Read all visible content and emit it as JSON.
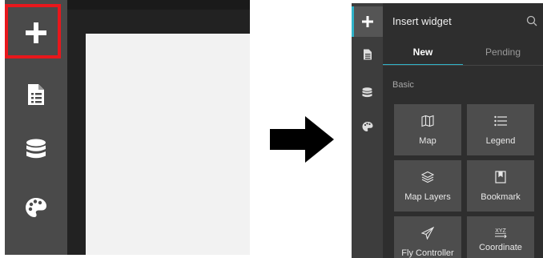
{
  "colors": {
    "highlight": "#e8171c",
    "accent": "#2fb2c8",
    "sidebar_bg": "#4a4a4a",
    "panel_bg": "#2e2e2e",
    "tile_bg": "#4d4d4d"
  },
  "left": {
    "icons": [
      "plus-icon",
      "document-icon",
      "database-icon",
      "palette-icon"
    ],
    "highlighted": "plus-icon"
  },
  "arrow": "right-arrow-icon",
  "panel": {
    "title": "Insert widget",
    "search_icon": "search-icon",
    "sidebar_icons": [
      "plus-icon",
      "document-icon",
      "database-icon",
      "palette-icon"
    ],
    "tabs": [
      {
        "label": "New",
        "active": true
      },
      {
        "label": "Pending",
        "active": false
      }
    ],
    "section": "Basic",
    "widgets": [
      {
        "label": "Map",
        "icon": "map-icon"
      },
      {
        "label": "Legend",
        "icon": "legend-icon"
      },
      {
        "label": "Map Layers",
        "icon": "layers-icon"
      },
      {
        "label": "Bookmark",
        "icon": "bookmark-icon"
      },
      {
        "label": "Fly Controller",
        "icon": "paper-plane-icon"
      },
      {
        "label": "Coordinate",
        "icon": "coordinate-icon"
      }
    ]
  }
}
